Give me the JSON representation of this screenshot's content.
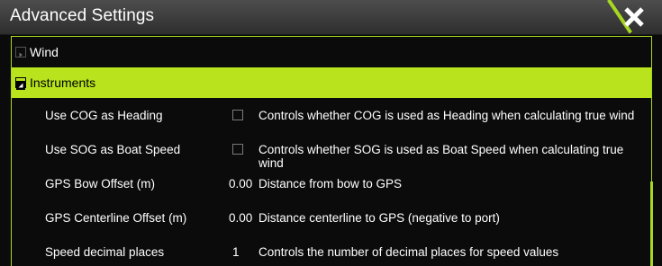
{
  "dialog": {
    "title": "Advanced Settings",
    "close_icon": "close-x-icon",
    "accent_color": "#a7d821"
  },
  "tree": {
    "wind": {
      "label": "Wind",
      "expanded": false
    },
    "instruments": {
      "label": "Instruments",
      "expanded": true,
      "selected": true
    }
  },
  "settings": [
    {
      "name": "Use COG as Heading",
      "control": "checkbox",
      "checked": false,
      "description": "Controls whether COG is used as Heading when calculating true wind"
    },
    {
      "name": "Use SOG as Boat Speed",
      "control": "checkbox",
      "checked": false,
      "description": "Controls whether SOG is used as Boat Speed when calculating true wind"
    },
    {
      "name": "GPS Bow Offset (m)",
      "control": "value",
      "value": "0.00",
      "description": "Distance from bow to GPS"
    },
    {
      "name": "GPS Centerline Offset (m)",
      "control": "value",
      "value": "0.00",
      "description": "Distance centerline to GPS (negative to port)"
    },
    {
      "name": "Speed decimal places",
      "control": "value",
      "value": "1",
      "description": "Controls the number of decimal places for speed values"
    }
  ]
}
